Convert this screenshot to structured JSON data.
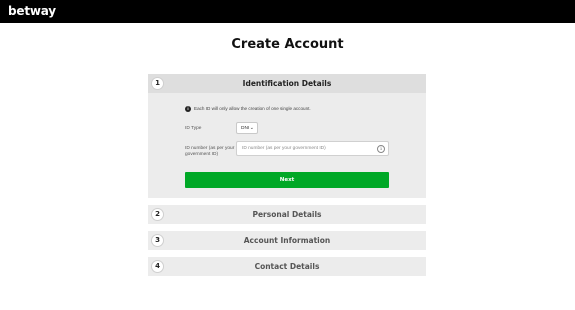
{
  "header": {
    "logo_text": "betway"
  },
  "page": {
    "title": "Create Account"
  },
  "steps": [
    {
      "number": "1",
      "title": "Identification Details"
    },
    {
      "number": "2",
      "title": "Personal Details"
    },
    {
      "number": "3",
      "title": "Account Information"
    },
    {
      "number": "4",
      "title": "Contact Details"
    }
  ],
  "identification": {
    "info_text": "Each ID will only allow the creation of one single account.",
    "id_type_label": "ID Type",
    "id_type_value": "DNI",
    "id_number_label": "ID number (as per your government ID)",
    "id_number_placeholder": "ID number (as per your government ID)",
    "next_label": "Next"
  },
  "colors": {
    "brand_black": "#000000",
    "accent_green": "#00a826",
    "panel_gray": "#ececec"
  },
  "icons": {
    "info": "info-icon",
    "chevron": "chevron-down-icon",
    "input_info": "info-circle-icon"
  }
}
